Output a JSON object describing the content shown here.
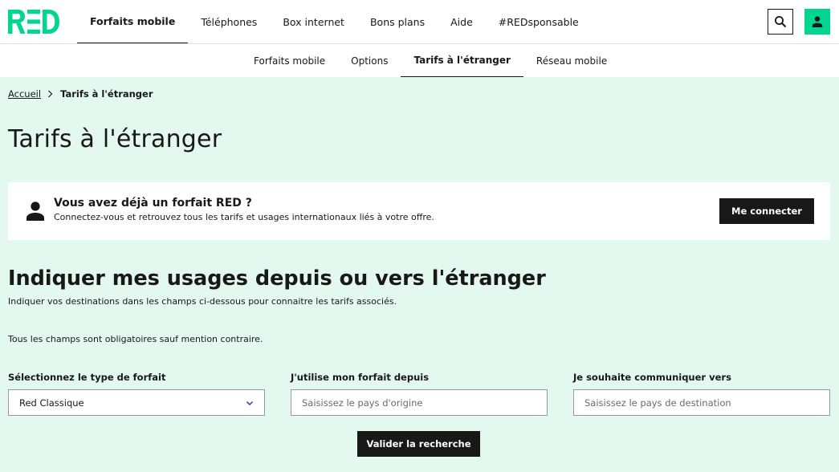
{
  "brand": {
    "logo_text": "RED",
    "accent_color": "#00d68f",
    "dark_color": "#181818",
    "background_color": "#e3f8ee"
  },
  "main_nav": {
    "items": [
      {
        "label": "Forfaits mobile",
        "active": true
      },
      {
        "label": "Téléphones",
        "active": false
      },
      {
        "label": "Box internet",
        "active": false
      },
      {
        "label": "Bons plans",
        "active": false
      },
      {
        "label": "Aide",
        "active": false
      },
      {
        "label": "#REDsponsable",
        "active": false
      }
    ]
  },
  "header_icons": {
    "search": "search-icon",
    "account": "person-icon"
  },
  "sub_nav": {
    "items": [
      {
        "label": "Forfaits mobile",
        "active": false
      },
      {
        "label": "Options",
        "active": false
      },
      {
        "label": "Tarifs à l'étranger",
        "active": true
      },
      {
        "label": "Réseau mobile",
        "active": false
      }
    ]
  },
  "breadcrumb": {
    "home": "Accueil",
    "current": "Tarifs à l'étranger"
  },
  "page_title": "Tarifs à l'étranger",
  "login_card": {
    "title": "Vous avez déjà un forfait RED ?",
    "text": "Connectez-vous et retrouvez tous les tarifs et usages internationaux liés à votre offre.",
    "button": "Me connecter"
  },
  "usage_section": {
    "title": "Indiquer mes usages depuis ou vers l'étranger",
    "description": "Indiquer vos destinations dans les champs ci-dessous pour connaitre les tarifs associés.",
    "mandatory_note": "Tous les champs sont obligatoires sauf mention contraire."
  },
  "form": {
    "plan_type": {
      "label": "Sélectionnez le type de forfait",
      "value": "Red Classique"
    },
    "origin": {
      "label": "J'utilise mon forfait depuis",
      "placeholder": "Saisissez le pays d'origine",
      "value": ""
    },
    "destination": {
      "label": "Je souhaite communiquer vers",
      "placeholder": "Saisissez le pays de destination",
      "value": ""
    },
    "submit": "Valider la recherche"
  }
}
